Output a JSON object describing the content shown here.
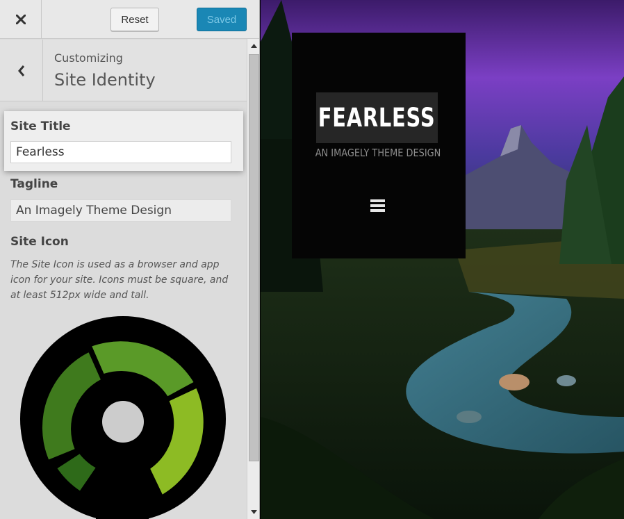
{
  "topbar": {
    "close_icon": "close-icon",
    "reset_label": "Reset",
    "saved_label": "Saved",
    "saved_color": "#1a87b5"
  },
  "section": {
    "back_icon": "chevron-left-icon",
    "crumb": "Customizing",
    "title": "Site Identity"
  },
  "fields": {
    "site_title": {
      "label": "Site Title",
      "value": "Fearless"
    },
    "tagline": {
      "label": "Tagline",
      "value": "An Imagely Theme Design"
    },
    "site_icon": {
      "label": "Site Icon",
      "description": "The Site Icon is used as a browser and app icon for your site. Icons must be square, and at least 512px wide and tall."
    }
  },
  "preview": {
    "site_title": "FEARLESS",
    "tagline": "AN IMAGELY THEME DESIGN",
    "menu_icon": "hamburger-menu-icon"
  },
  "colors": {
    "panel_bg": "#dcdcdc",
    "icon_green_dark": "#3f7a1d",
    "icon_green_mid": "#5a9a28",
    "icon_green_light": "#8dbb24"
  }
}
